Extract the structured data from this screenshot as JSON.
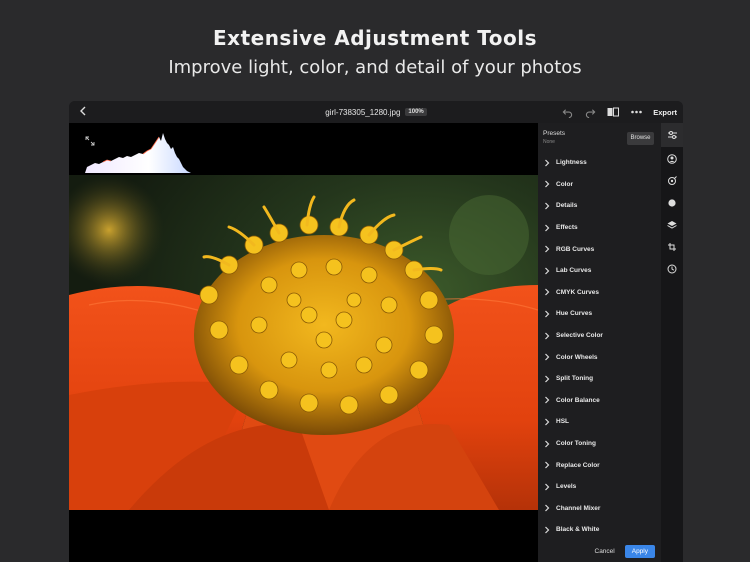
{
  "hero": {
    "title": "Extensive Adjustment Tools",
    "subtitle": "Improve light, color, and detail of your photos"
  },
  "toolbar": {
    "filename": "girl-738305_1280.jpg",
    "zoom": "100%",
    "export_label": "Export",
    "icons": [
      "back-icon",
      "undo-icon",
      "redo-icon",
      "compare-icon",
      "more-icon"
    ]
  },
  "panel": {
    "presets_title": "Presets",
    "presets_value": "None",
    "browse_label": "Browse",
    "items": [
      {
        "label": "Lightness"
      },
      {
        "label": "Color"
      },
      {
        "label": "Details"
      },
      {
        "label": "Effects"
      },
      {
        "label": "RGB Curves"
      },
      {
        "label": "Lab Curves"
      },
      {
        "label": "CMYK Curves"
      },
      {
        "label": "Hue Curves"
      },
      {
        "label": "Selective Color"
      },
      {
        "label": "Color Wheels"
      },
      {
        "label": "Split Toning"
      },
      {
        "label": "Color Balance"
      },
      {
        "label": "HSL"
      },
      {
        "label": "Color Toning"
      },
      {
        "label": "Replace Color"
      },
      {
        "label": "Levels"
      },
      {
        "label": "Channel Mixer"
      },
      {
        "label": "Black & White"
      }
    ],
    "cancel_label": "Cancel",
    "apply_label": "Apply"
  },
  "rail": {
    "icons": [
      "sliders-icon",
      "portrait-icon",
      "retouch-icon",
      "circle-icon",
      "layers-icon",
      "transform-icon",
      "history-icon"
    ]
  },
  "colors": {
    "accent": "#3a86e8",
    "panel_bg": "#1e1e20"
  }
}
